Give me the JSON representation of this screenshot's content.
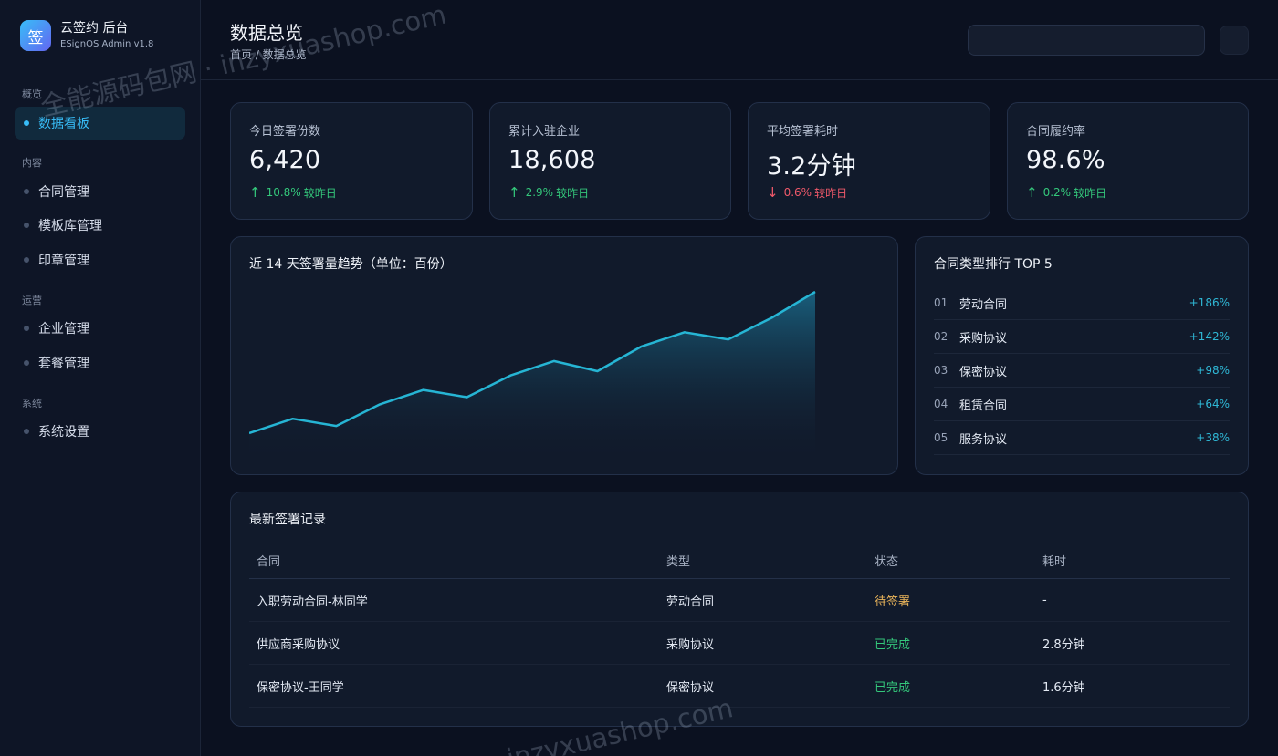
{
  "brand": {
    "logo_char": "签",
    "title": "云签约 后台",
    "subtitle": "ESignOS Admin v1.8"
  },
  "sidebar": {
    "sections": [
      {
        "label": "概览",
        "items": [
          {
            "label": "数据看板",
            "active": true
          }
        ]
      },
      {
        "label": "内容",
        "items": [
          {
            "label": "合同管理"
          },
          {
            "label": "模板库管理"
          },
          {
            "label": "印章管理"
          }
        ]
      },
      {
        "label": "运营",
        "items": [
          {
            "label": "企业管理"
          },
          {
            "label": "套餐管理"
          }
        ]
      },
      {
        "label": "系统",
        "items": [
          {
            "label": "系统设置"
          }
        ]
      }
    ]
  },
  "header": {
    "title": "数据总览",
    "breadcrumb": "首页 / 数据总览",
    "search_value": "",
    "icon_button": "notification-icon"
  },
  "stats": [
    {
      "label": "今日签署份数",
      "value": "6,420",
      "trend": "up",
      "arrow": "↑",
      "delta": "10.8%",
      "note": "较昨日"
    },
    {
      "label": "累计入驻企业",
      "value": "18,608",
      "trend": "up",
      "arrow": "↑",
      "delta": "2.9%",
      "note": "较昨日"
    },
    {
      "label": "平均签署耗时",
      "value": "3.2分钟",
      "trend": "down",
      "arrow": "↓",
      "delta": "0.6%",
      "note": "较昨日"
    },
    {
      "label": "合同履约率",
      "value": "98.6%",
      "trend": "up",
      "arrow": "↑",
      "delta": "0.2%",
      "note": "较昨日"
    }
  ],
  "trend_panel": {
    "title": "近 14 天签署量趋势（单位：百份）"
  },
  "chart_data": {
    "type": "area",
    "title": "近 14 天签署量趋势（单位：百份）",
    "x": [
      1,
      2,
      3,
      4,
      5,
      6,
      7,
      8,
      9,
      10,
      11,
      12,
      13,
      14
    ],
    "series": [
      {
        "values": [
          12,
          22,
          17,
          32,
          42,
          37,
          52,
          62,
          55,
          72,
          82,
          77,
          92,
          110
        ]
      }
    ],
    "ylim": [
      0,
      110
    ],
    "grid": false,
    "legend": "none",
    "colors": {
      "line": "#26b5d4",
      "fill_top": "#1a6a8a"
    }
  },
  "ranking": {
    "title": "合同类型排行 TOP 5",
    "items": [
      {
        "no": "01",
        "name": "劳动合同",
        "growth": "+186%"
      },
      {
        "no": "02",
        "name": "采购协议",
        "growth": "+142%"
      },
      {
        "no": "03",
        "name": "保密协议",
        "growth": "+98%"
      },
      {
        "no": "04",
        "name": "租赁合同",
        "growth": "+64%"
      },
      {
        "no": "05",
        "name": "服务协议",
        "growth": "+38%"
      }
    ]
  },
  "records": {
    "title": "最新签署记录",
    "columns": [
      "合同",
      "类型",
      "状态",
      "耗时"
    ],
    "rows": [
      {
        "contract": "入职劳动合同-林同学",
        "type": "劳动合同",
        "status": "待签署",
        "status_kind": "pending",
        "duration": "-"
      },
      {
        "contract": "供应商采购协议",
        "type": "采购协议",
        "status": "已完成",
        "status_kind": "done",
        "duration": "2.8分钟"
      },
      {
        "contract": "保密协议-王同学",
        "type": "保密协议",
        "status": "已完成",
        "status_kind": "done",
        "duration": "1.6分钟"
      }
    ]
  },
  "watermarks": [
    "全能源码包网 · inzyxuashop.com",
    "inzyxuashop.com"
  ],
  "colors": {
    "accent": "#38bdf8",
    "up": "#34c77b",
    "down": "#f0596a",
    "pending": "#e8b35a"
  }
}
